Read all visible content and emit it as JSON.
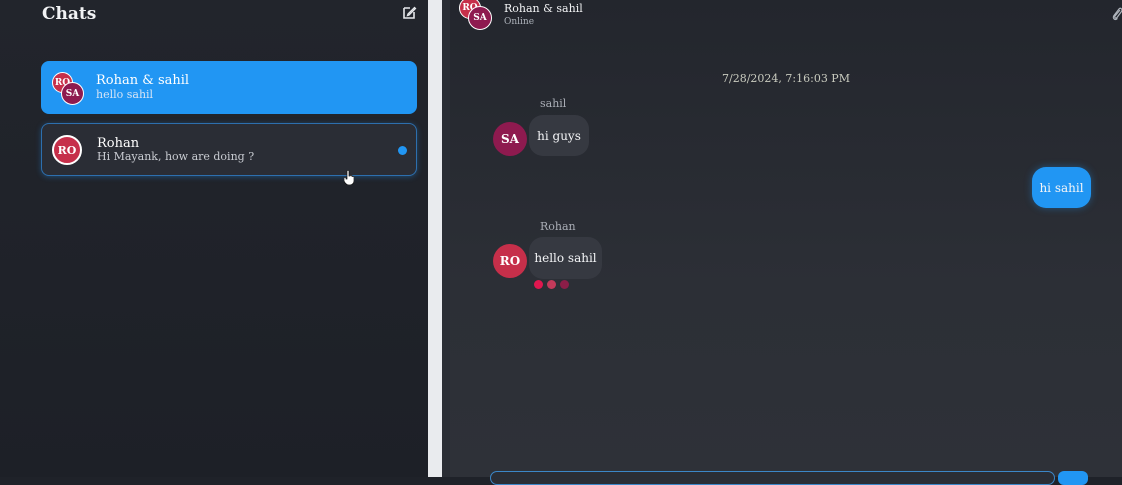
{
  "sidebar": {
    "title": "Chats",
    "compose_icon": "edit-icon",
    "chats": [
      {
        "name": "Rohan & sahil",
        "preview": "hello sahil",
        "avatars": [
          "RO",
          "SA"
        ],
        "active": true
      },
      {
        "name": "Rohan",
        "preview": "Hi Mayank, how are doing ?",
        "avatars": [
          "RO"
        ],
        "active": false,
        "unread": true
      }
    ]
  },
  "conversation": {
    "header": {
      "name": "Rohan & sahil",
      "status": "Online",
      "avatars": [
        "RO",
        "SA"
      ]
    },
    "attach_icon": "paperclip-icon",
    "timestamp": "7/28/2024, 7:16:03 PM",
    "messages": [
      {
        "sender": "sahil",
        "avatar": "SA",
        "text": "hi guys",
        "direction": "incoming"
      },
      {
        "sender": "",
        "avatar": "",
        "text": "hi sahil",
        "direction": "outgoing"
      },
      {
        "sender": "Rohan",
        "avatar": "RO",
        "text": "hello sahil",
        "direction": "incoming"
      }
    ],
    "typing_indicator_colors": [
      "#e0174f",
      "#c23a5a",
      "#8c1e48"
    ]
  },
  "colors": {
    "accent": "#2196f3",
    "avatar_ro": "#c62f4a",
    "avatar_sa": "#8e1a4f"
  }
}
